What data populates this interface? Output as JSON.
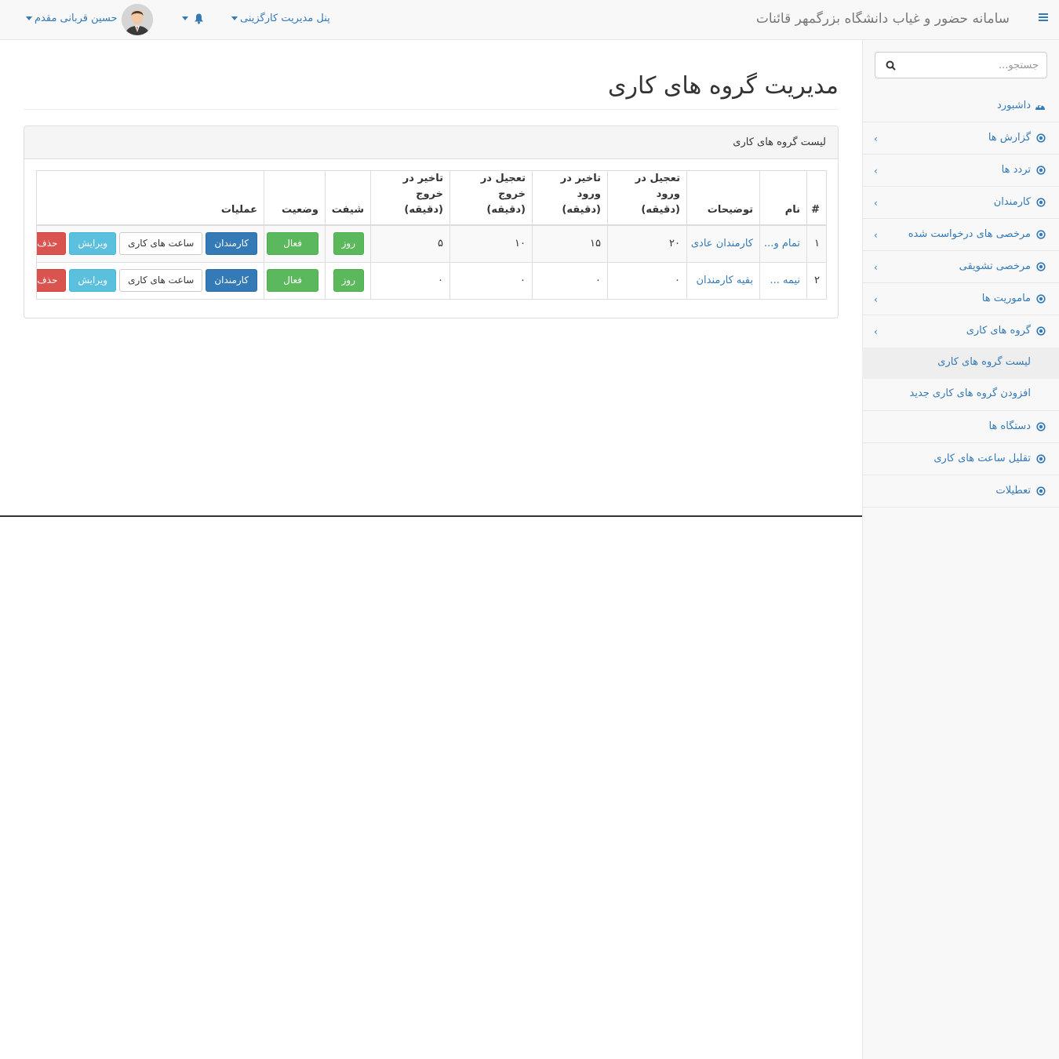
{
  "navbar": {
    "brand": "سامانه حضور و غیاب دانشگاه بزرگمهر قائنات",
    "panel_menu": "پنل مدیریت کارگزینی",
    "user_name": "حسین قربانی مقدم"
  },
  "sidebar": {
    "search_placeholder": "جستجو...",
    "items": [
      {
        "label": "داشبورد",
        "icon": "dashboard-icon",
        "has_children": false
      },
      {
        "label": "گزارش ها",
        "icon": "circle-icon",
        "has_children": true
      },
      {
        "label": "تردد ها",
        "icon": "circle-icon",
        "has_children": true
      },
      {
        "label": "کارمندان",
        "icon": "circle-icon",
        "has_children": true
      },
      {
        "label": "مرخصی های درخواست شده",
        "icon": "circle-icon",
        "has_children": true
      },
      {
        "label": "مرخصی تشویقی",
        "icon": "circle-icon",
        "has_children": true
      },
      {
        "label": "ماموریت ها",
        "icon": "circle-icon",
        "has_children": true
      },
      {
        "label": "گروه های کاری",
        "icon": "circle-icon",
        "has_children": true
      }
    ],
    "subitems": [
      {
        "label": "لیست گروه های کاری",
        "active": true
      },
      {
        "label": "افزودن گروه های کاری جدید",
        "active": false
      }
    ],
    "items_after": [
      {
        "label": "دستگاه ها",
        "icon": "circle-icon"
      },
      {
        "label": "تقلیل ساعت های کاری",
        "icon": "circle-icon"
      },
      {
        "label": "تعطیلات",
        "icon": "circle-icon"
      }
    ]
  },
  "main": {
    "title": "مدیریت گروه های کاری",
    "panel_title": "لیست گروه های کاری",
    "table": {
      "headers": [
        "#",
        "نام",
        "توضیحات",
        "تعجیل در ورود (دقیقه)",
        "تاخیر در ورود (دقیقه)",
        "تعجیل در خروج (دقیقه)",
        "تاخیر در خروج (دقیقه)",
        "شیفت",
        "وضعیت",
        "عملیات"
      ],
      "rows": [
        {
          "num": "۱",
          "name": "تمام و...",
          "desc": "کارمندان عادی",
          "early_in": "۲۰",
          "late_in": "۱۵",
          "early_out": "۱۰",
          "late_out": "۵",
          "shift": "روز",
          "status": "فعال"
        },
        {
          "num": "۲",
          "name": "نیمه ...",
          "desc": "بقیه کارمندان",
          "early_in": "۰",
          "late_in": "۰",
          "early_out": "۰",
          "late_out": "۰",
          "shift": "روز",
          "status": "فعال"
        }
      ],
      "actions": {
        "employees": "کارمندان",
        "hours": "ساعت های کاری",
        "edit": "ویرایش",
        "delete": "حذف"
      }
    }
  },
  "colors": {
    "link": "#337ab7",
    "success": "#5cb85c",
    "primary": "#337ab7",
    "info": "#5bc0de",
    "danger": "#d9534f"
  }
}
